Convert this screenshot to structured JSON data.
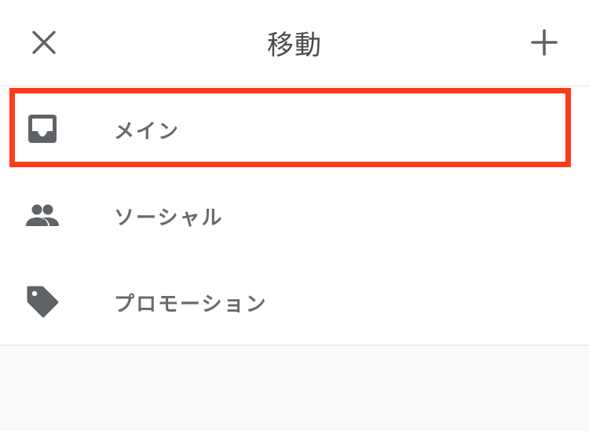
{
  "header": {
    "title": "移動",
    "close_icon": "close-icon",
    "add_icon": "plus-icon"
  },
  "items": [
    {
      "label": "メイン",
      "icon": "inbox-icon",
      "highlighted": true
    },
    {
      "label": "ソーシャル",
      "icon": "people-icon",
      "highlighted": false
    },
    {
      "label": "プロモーション",
      "icon": "tag-icon",
      "highlighted": false
    }
  ],
  "colors": {
    "highlight": "#ff3b18",
    "icon": "#5f6368",
    "text": "#6a6a6a",
    "background": "#ffffff",
    "footer_background": "#fafafa"
  }
}
